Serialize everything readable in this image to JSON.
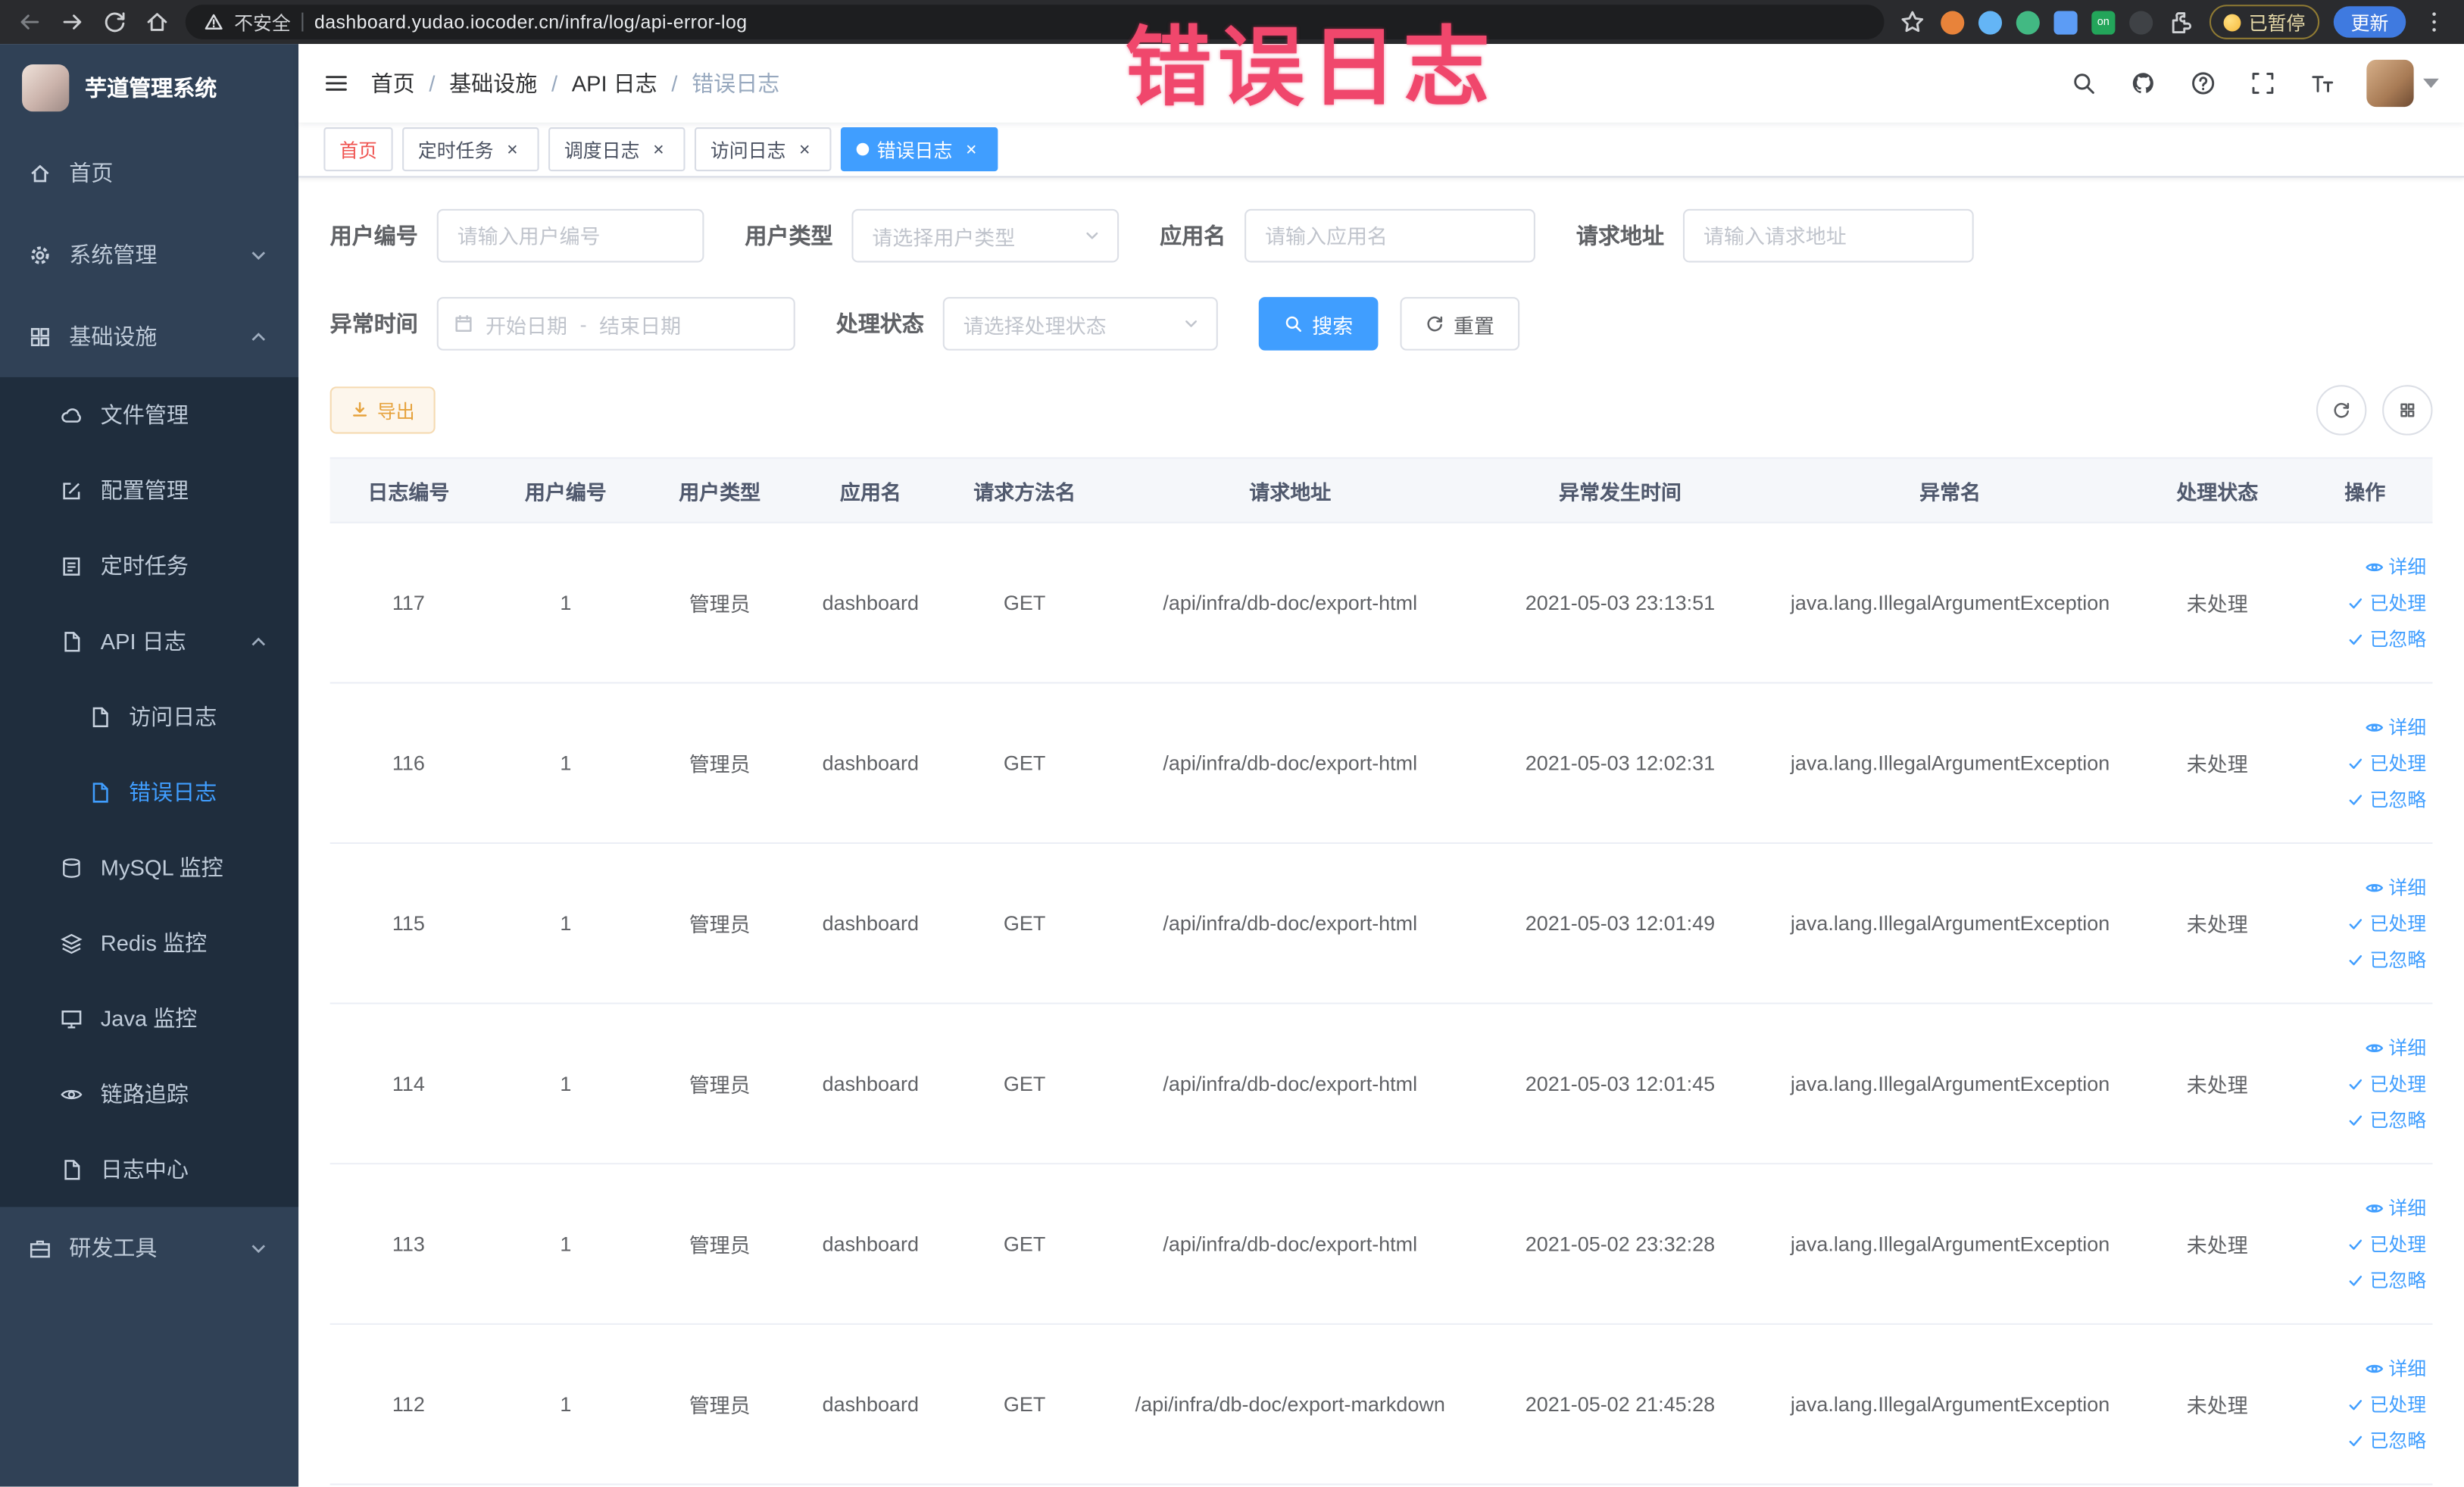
{
  "browser": {
    "security_label": "不安全",
    "url": "dashboard.yudao.iocoder.cn/infra/log/api-error-log",
    "extension_on_badge": "on",
    "paused_badge": "已暂停",
    "update_label": "更新"
  },
  "annotation": "错误日志",
  "sidebar": {
    "logo_title": "芋道管理系统",
    "items": {
      "home": "首页",
      "system": "系统管理",
      "infra": "基础设施",
      "file": "文件管理",
      "config": "配置管理",
      "job": "定时任务",
      "api_log": "API 日志",
      "access_log": "访问日志",
      "error_log": "错误日志",
      "mysql": "MySQL 监控",
      "redis": "Redis 监控",
      "java": "Java 监控",
      "trace": "链路追踪",
      "log_center": "日志中心",
      "dev_tools": "研发工具"
    }
  },
  "navbar": {
    "breadcrumb": [
      "首页",
      "基础设施",
      "API 日志",
      "错误日志"
    ]
  },
  "tabs": {
    "home": "首页",
    "job": "定时任务",
    "job_log": "调度日志",
    "access_log": "访问日志",
    "error_log": "错误日志"
  },
  "filters": {
    "user_id_label": "用户编号",
    "user_id_placeholder": "请输入用户编号",
    "user_type_label": "用户类型",
    "user_type_placeholder": "请选择用户类型",
    "app_name_label": "应用名",
    "app_name_placeholder": "请输入应用名",
    "request_url_label": "请求地址",
    "request_url_placeholder": "请输入请求地址",
    "time_label": "异常时间",
    "time_start_placeholder": "开始日期",
    "time_separator": "-",
    "time_end_placeholder": "结束日期",
    "status_label": "处理状态",
    "status_placeholder": "请选择处理状态",
    "search_label": "搜索",
    "reset_label": "重置"
  },
  "toolbar": {
    "export_label": "导出"
  },
  "table": {
    "columns": [
      "日志编号",
      "用户编号",
      "用户类型",
      "应用名",
      "请求方法名",
      "请求地址",
      "异常发生时间",
      "异常名",
      "处理状态",
      "操作"
    ],
    "actions": {
      "detail": "详细",
      "processed": "已处理",
      "ignored": "已忽略"
    },
    "rows": [
      {
        "id": "117",
        "user_id": "1",
        "user_type": "管理员",
        "app": "dashboard",
        "method": "GET",
        "url": "/api/infra/db-doc/export-html",
        "time": "2021-05-03 23:13:51",
        "exception": "java.lang.IllegalArgumentException",
        "status": "未处理"
      },
      {
        "id": "116",
        "user_id": "1",
        "user_type": "管理员",
        "app": "dashboard",
        "method": "GET",
        "url": "/api/infra/db-doc/export-html",
        "time": "2021-05-03 12:02:31",
        "exception": "java.lang.IllegalArgumentException",
        "status": "未处理"
      },
      {
        "id": "115",
        "user_id": "1",
        "user_type": "管理员",
        "app": "dashboard",
        "method": "GET",
        "url": "/api/infra/db-doc/export-html",
        "time": "2021-05-03 12:01:49",
        "exception": "java.lang.IllegalArgumentException",
        "status": "未处理"
      },
      {
        "id": "114",
        "user_id": "1",
        "user_type": "管理员",
        "app": "dashboard",
        "method": "GET",
        "url": "/api/infra/db-doc/export-html",
        "time": "2021-05-03 12:01:45",
        "exception": "java.lang.IllegalArgumentException",
        "status": "未处理"
      },
      {
        "id": "113",
        "user_id": "1",
        "user_type": "管理员",
        "app": "dashboard",
        "method": "GET",
        "url": "/api/infra/db-doc/export-html",
        "time": "2021-05-02 23:32:28",
        "exception": "java.lang.IllegalArgumentException",
        "status": "未处理"
      },
      {
        "id": "112",
        "user_id": "1",
        "user_type": "管理员",
        "app": "dashboard",
        "method": "GET",
        "url": "/api/infra/db-doc/export-markdown",
        "time": "2021-05-02 21:45:28",
        "exception": "java.lang.IllegalArgumentException",
        "status": "未处理"
      }
    ]
  }
}
